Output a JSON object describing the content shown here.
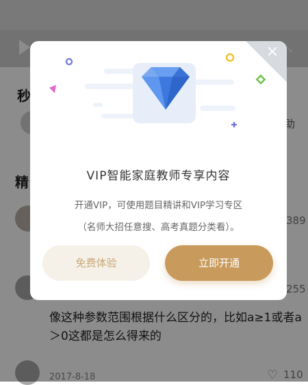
{
  "modal": {
    "close_label": "×",
    "title": "VIP智能家庭教师专享内容",
    "desc_line1": "开通VIP，可使用题目精讲和VIP学习专区",
    "desc_line2": "（名师大招任意搜、高考真题分类看）。",
    "free_button": "免费体验",
    "open_button": "立即开通"
  },
  "background": {
    "section1_title": "秒",
    "section1_side": "助",
    "section2_title": "精",
    "count1": "389",
    "count2": "255",
    "question": "像这种参数范围根据什么区分的，比如a≥1或者a＞0这都是怎么得来的",
    "date": "2017-8-18",
    "likes": "110"
  },
  "colors": {
    "gold": "#c89a5c",
    "gold_light": "#f6f1e8",
    "diamond": "#3c7fe8"
  },
  "icons": [
    "play-icon",
    "fullscreen-icon",
    "close-icon",
    "diamond-icon",
    "heart-icon"
  ]
}
